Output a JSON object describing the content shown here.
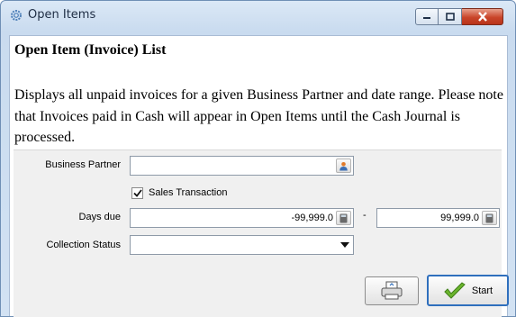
{
  "window": {
    "title": "Open Items",
    "icon": "gear-icon",
    "controls": {
      "minimize": "minimize-icon",
      "maximize": "maximize-icon",
      "close": "close-icon"
    }
  },
  "header": {
    "title": "Open Item (Invoice) List",
    "description": "Displays all unpaid invoices for a given Business Partner and date range. Please note that Invoices paid in Cash will appear in Open Items until the Cash Journal is processed."
  },
  "form": {
    "business_partner": {
      "label": "Business Partner",
      "value": "",
      "button_icon": "person-icon"
    },
    "sales_transaction": {
      "label": "Sales Transaction",
      "checked": true
    },
    "days_due": {
      "label": "Days due",
      "from": "-99,999.0",
      "separator": "-",
      "to": "99,999.0",
      "button_icon": "calculator-icon"
    },
    "collection_status": {
      "label": "Collection Status",
      "value": ""
    }
  },
  "buttons": {
    "print_icon": "printer-icon",
    "start": "Start",
    "start_icon": "checkmark-icon"
  },
  "colors": {
    "accent": "#2f6fbd",
    "close": "#c9452a",
    "check": "#6cb52e"
  }
}
